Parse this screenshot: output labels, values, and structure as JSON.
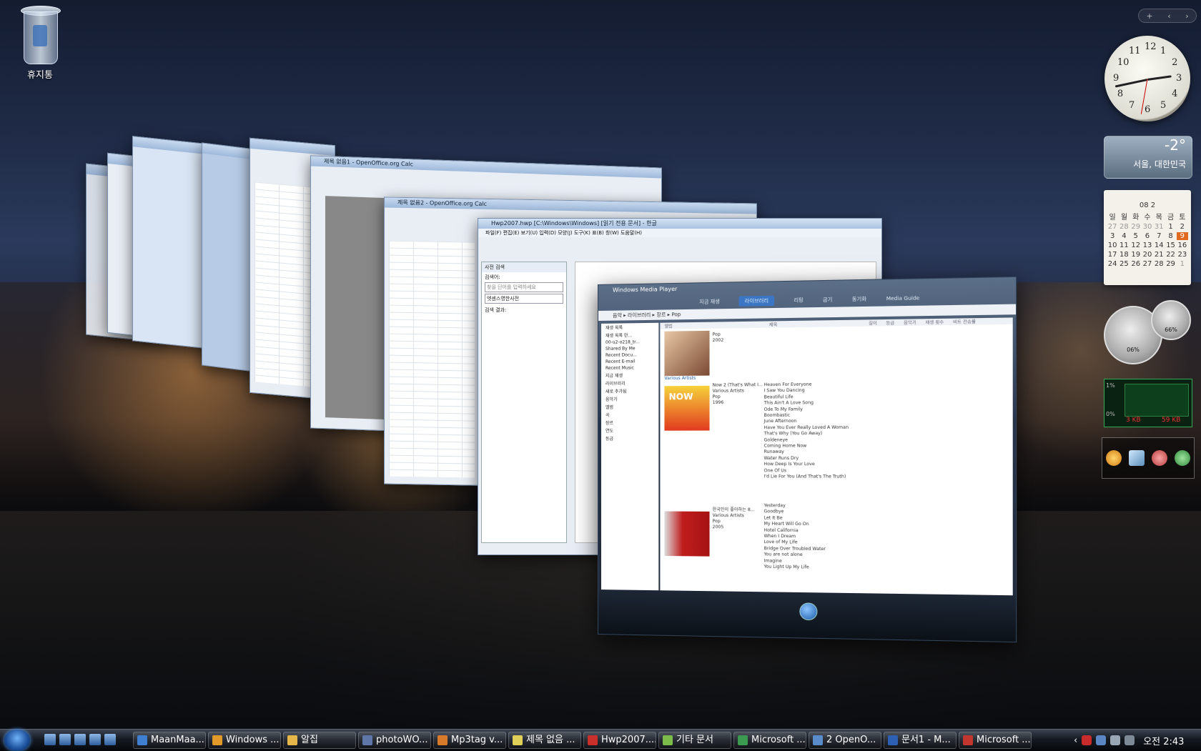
{
  "desktop": {
    "icons": [
      {
        "label": "휴지통",
        "icon": "recycle-bin-icon"
      }
    ]
  },
  "windows": {
    "calc_title": "제목 없음1 - OpenOffice.org Calc",
    "calc2_title": "제목 없음2 - OpenOffice.org Calc",
    "hwp_title": "Hwp2007.hwp [C:\\Windows\\Windows] [읽기 전용 문서] - 한글",
    "hwp_menu": "파일(F) 편집(E) 보기(U) 입력(D) 모양(J) 도구(K) 표(B) 창(W) 도움말(H)",
    "hwp_panel_title": "사전 검색",
    "hwp_panel_search_label": "검색어:",
    "hwp_panel_placeholder": "찾을 단어를 입력하세요",
    "hwp_panel_dict": "엣센스영한사전",
    "hwp_panel_results": "검색 결과:"
  },
  "wmp": {
    "title": "Windows Media Player",
    "tabs": [
      "지금 재생",
      "라이브러리",
      "리핑",
      "굽기",
      "동기화",
      "Media Guide"
    ],
    "active_tab": "라이브러리",
    "breadcrumb": "음악 ▸ 라이브러리 ▸ 장르 ▸ Pop",
    "search_placeholder": "검색",
    "nav": [
      "재생 목록",
      "재생 목록 만...",
      "00-u2-o218_tr...",
      "Shared By Me",
      "Recent Docu...",
      "Recent E-mail",
      "Recent Music",
      "지금 재생",
      "라이브러리",
      "새로 추가됨",
      "음악가",
      "앨범",
      "곡",
      "장르",
      "연도",
      "등급"
    ],
    "columns": [
      "앨범",
      "제목",
      "길이",
      "등급",
      "음악가",
      "재생 횟수",
      "비트 전송률"
    ],
    "albums": [
      {
        "group": "",
        "name": "Pop",
        "year": "2002"
      },
      {
        "group": "Various Artists",
        "name": "Now 2 (That's What I...",
        "artist": "Various Artists",
        "genre": "Pop",
        "year": "1996"
      },
      {
        "group": "",
        "name": "한국인이 좋아하는 8...",
        "artist": "Various Artists",
        "genre": "Pop",
        "year": "2005"
      }
    ],
    "tracks_now2": [
      "Heaven For Everyone",
      "I Saw You Dancing",
      "Beautiful Life",
      "This Ain't A Love Song",
      "Ode To My Family",
      "Boombastic",
      "June Afternoon",
      "Have You Ever Really Loved A Woman",
      "That's Why (You Go Away)",
      "Goldeneye",
      "Coming Home Now",
      "Runaway",
      "Water Runs Dry",
      "How Deep Is Your Love",
      "One Of Us",
      "I'd Lie For You (And That's The Truth)"
    ],
    "tracks_korean": [
      "Yesterday",
      "Goodbye",
      "Let It Be",
      "My Heart Will Go On",
      "Hotel California",
      "When I Dream",
      "Love of My Life",
      "Bridge Over Troubled Water",
      "You are not alone",
      "Imagine",
      "You Light Up My Life"
    ]
  },
  "gadgets": {
    "clock_numbers": [
      "12",
      "1",
      "2",
      "3",
      "4",
      "5",
      "6",
      "7",
      "8",
      "9",
      "10",
      "11"
    ],
    "weather_temp": "-2°",
    "weather_city": "서울, 대한민국",
    "calendar_header": "08 2",
    "calendar_weekdays": [
      "일",
      "월",
      "화",
      "수",
      "목",
      "금",
      "토"
    ],
    "calendar_rows": [
      [
        "27",
        "28",
        "29",
        "30",
        "31",
        "1",
        "2"
      ],
      [
        "3",
        "4",
        "5",
        "6",
        "7",
        "8",
        "9"
      ],
      [
        "10",
        "11",
        "12",
        "13",
        "14",
        "15",
        "16"
      ],
      [
        "17",
        "18",
        "19",
        "20",
        "21",
        "22",
        "23"
      ],
      [
        "24",
        "25",
        "26",
        "27",
        "28",
        "29",
        "1"
      ]
    ],
    "cpu_meter": "06%",
    "mem_meter": "66%",
    "net_top": "1%",
    "net_bottom": "0%",
    "net_in": "3 KB",
    "net_out": "59 KB"
  },
  "taskbar": {
    "tasks": [
      {
        "label": "MaanMaa...",
        "color": "#3f7fd1"
      },
      {
        "label": "Windows ...",
        "color": "#e39a2a"
      },
      {
        "label": "알집",
        "color": "#e6b64b"
      },
      {
        "label": "photoWO...",
        "color": "#5f77a8"
      },
      {
        "label": "Mp3tag v...",
        "color": "#d77b2b"
      },
      {
        "label": "제목 없음 ...",
        "color": "#e0d05a"
      },
      {
        "label": "Hwp2007....",
        "color": "#c9302c"
      },
      {
        "label": "기타 문서",
        "color": "#7cbc4a"
      },
      {
        "label": "Microsoft ...",
        "color": "#3c9a50"
      },
      {
        "label": "2 OpenO...",
        "color": "#5a8cc9"
      },
      {
        "label": "문서1 - M...",
        "color": "#2d5fb2"
      },
      {
        "label": "Microsoft ...",
        "color": "#c3362f"
      }
    ],
    "clock": "오전 2:43"
  }
}
